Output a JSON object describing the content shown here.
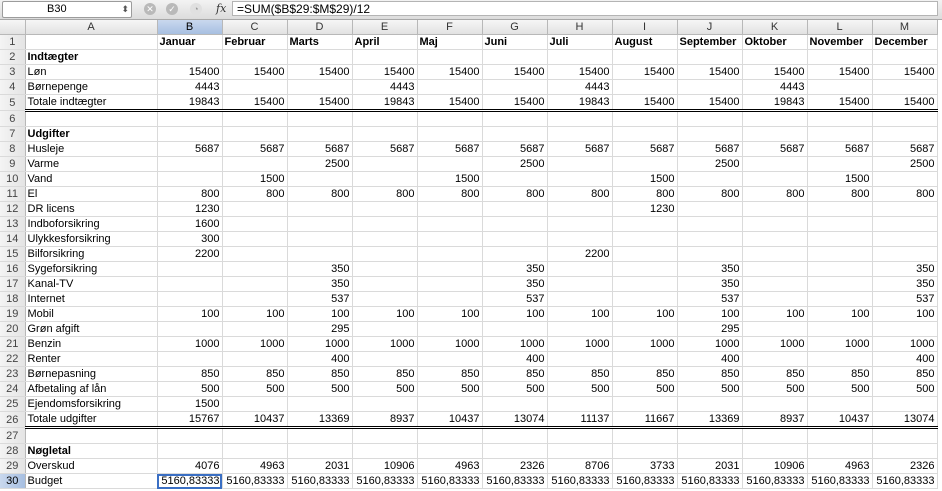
{
  "formula_bar": {
    "name_box": "B30",
    "formula": "=SUM($B$29:$M$29)/12",
    "fx_label": "fx"
  },
  "columns": [
    "A",
    "B",
    "C",
    "D",
    "E",
    "F",
    "G",
    "H",
    "I",
    "J",
    "K",
    "L",
    "M"
  ],
  "active_cell": {
    "row": 30,
    "col": "B"
  },
  "rows": [
    {
      "n": "1",
      "cells": [
        "",
        "Januar",
        "Februar",
        "Marts",
        "April",
        "Maj",
        "Juni",
        "Juli",
        "August",
        "September",
        "Oktober",
        "November",
        "December"
      ],
      "header": true
    },
    {
      "n": "2",
      "cells": [
        "Indtægter",
        "",
        "",
        "",
        "",
        "",
        "",
        "",
        "",
        "",
        "",
        "",
        ""
      ],
      "bold": true
    },
    {
      "n": "3",
      "cells": [
        "Løn",
        "15400",
        "15400",
        "15400",
        "15400",
        "15400",
        "15400",
        "15400",
        "15400",
        "15400",
        "15400",
        "15400",
        "15400"
      ]
    },
    {
      "n": "4",
      "cells": [
        "Børnepenge",
        "4443",
        "",
        "",
        "4443",
        "",
        "",
        "4443",
        "",
        "",
        "4443",
        "",
        ""
      ]
    },
    {
      "n": "5",
      "cells": [
        "Totale indtægter",
        "19843",
        "15400",
        "15400",
        "19843",
        "15400",
        "15400",
        "19843",
        "15400",
        "15400",
        "19843",
        "15400",
        "15400"
      ],
      "total": true
    },
    {
      "n": "6",
      "cells": [
        "",
        "",
        "",
        "",
        "",
        "",
        "",
        "",
        "",
        "",
        "",
        "",
        ""
      ]
    },
    {
      "n": "7",
      "cells": [
        "Udgifter",
        "",
        "",
        "",
        "",
        "",
        "",
        "",
        "",
        "",
        "",
        "",
        ""
      ],
      "bold": true
    },
    {
      "n": "8",
      "cells": [
        "Husleje",
        "5687",
        "5687",
        "5687",
        "5687",
        "5687",
        "5687",
        "5687",
        "5687",
        "5687",
        "5687",
        "5687",
        "5687"
      ]
    },
    {
      "n": "9",
      "cells": [
        "Varme",
        "",
        "",
        "2500",
        "",
        "",
        "2500",
        "",
        "",
        "2500",
        "",
        "",
        "2500"
      ]
    },
    {
      "n": "10",
      "cells": [
        "Vand",
        "",
        "1500",
        "",
        "",
        "1500",
        "",
        "",
        "1500",
        "",
        "",
        "1500",
        ""
      ]
    },
    {
      "n": "11",
      "cells": [
        "El",
        "800",
        "800",
        "800",
        "800",
        "800",
        "800",
        "800",
        "800",
        "800",
        "800",
        "800",
        "800"
      ]
    },
    {
      "n": "12",
      "cells": [
        "DR licens",
        "1230",
        "",
        "",
        "",
        "",
        "",
        "",
        "1230",
        "",
        "",
        "",
        ""
      ]
    },
    {
      "n": "13",
      "cells": [
        "Indboforsikring",
        "1600",
        "",
        "",
        "",
        "",
        "",
        "",
        "",
        "",
        "",
        "",
        ""
      ]
    },
    {
      "n": "14",
      "cells": [
        "Ulykkesforsikring",
        "300",
        "",
        "",
        "",
        "",
        "",
        "",
        "",
        "",
        "",
        "",
        ""
      ]
    },
    {
      "n": "15",
      "cells": [
        "Bilforsikring",
        "2200",
        "",
        "",
        "",
        "",
        "",
        "2200",
        "",
        "",
        "",
        "",
        ""
      ]
    },
    {
      "n": "16",
      "cells": [
        "Sygeforsikring",
        "",
        "",
        "350",
        "",
        "",
        "350",
        "",
        "",
        "350",
        "",
        "",
        "350"
      ]
    },
    {
      "n": "17",
      "cells": [
        "Kanal-TV",
        "",
        "",
        "350",
        "",
        "",
        "350",
        "",
        "",
        "350",
        "",
        "",
        "350"
      ]
    },
    {
      "n": "18",
      "cells": [
        "Internet",
        "",
        "",
        "537",
        "",
        "",
        "537",
        "",
        "",
        "537",
        "",
        "",
        "537"
      ]
    },
    {
      "n": "19",
      "cells": [
        "Mobil",
        "100",
        "100",
        "100",
        "100",
        "100",
        "100",
        "100",
        "100",
        "100",
        "100",
        "100",
        "100"
      ]
    },
    {
      "n": "20",
      "cells": [
        "Grøn afgift",
        "",
        "",
        "295",
        "",
        "",
        "",
        "",
        "",
        "295",
        "",
        "",
        ""
      ]
    },
    {
      "n": "21",
      "cells": [
        "Benzin",
        "1000",
        "1000",
        "1000",
        "1000",
        "1000",
        "1000",
        "1000",
        "1000",
        "1000",
        "1000",
        "1000",
        "1000"
      ]
    },
    {
      "n": "22",
      "cells": [
        "Renter",
        "",
        "",
        "400",
        "",
        "",
        "400",
        "",
        "",
        "400",
        "",
        "",
        "400"
      ]
    },
    {
      "n": "23",
      "cells": [
        "Børnepasning",
        "850",
        "850",
        "850",
        "850",
        "850",
        "850",
        "850",
        "850",
        "850",
        "850",
        "850",
        "850"
      ]
    },
    {
      "n": "24",
      "cells": [
        "Afbetaling af lån",
        "500",
        "500",
        "500",
        "500",
        "500",
        "500",
        "500",
        "500",
        "500",
        "500",
        "500",
        "500"
      ]
    },
    {
      "n": "25",
      "cells": [
        "Ejendomsforsikring",
        "1500",
        "",
        "",
        "",
        "",
        "",
        "",
        "",
        "",
        "",
        "",
        ""
      ]
    },
    {
      "n": "26",
      "cells": [
        "Totale udgifter",
        "15767",
        "10437",
        "13369",
        "8937",
        "10437",
        "13074",
        "11137",
        "11667",
        "13369",
        "8937",
        "10437",
        "13074"
      ],
      "total": true
    },
    {
      "n": "27",
      "cells": [
        "",
        "",
        "",
        "",
        "",
        "",
        "",
        "",
        "",
        "",
        "",
        "",
        ""
      ]
    },
    {
      "n": "28",
      "cells": [
        "Nøgletal",
        "",
        "",
        "",
        "",
        "",
        "",
        "",
        "",
        "",
        "",
        "",
        ""
      ],
      "bold": true
    },
    {
      "n": "29",
      "cells": [
        "Overskud",
        "4076",
        "4963",
        "2031",
        "10906",
        "4963",
        "2326",
        "8706",
        "3733",
        "2031",
        "10906",
        "4963",
        "2326"
      ]
    },
    {
      "n": "30",
      "cells": [
        "Budget",
        "5160,83333",
        "5160,83333",
        "5160,83333",
        "5160,83333",
        "5160,83333",
        "5160,83333",
        "5160,83333",
        "5160,83333",
        "5160,83333",
        "5160,83333",
        "5160,83333",
        "5160,83333"
      ]
    }
  ]
}
